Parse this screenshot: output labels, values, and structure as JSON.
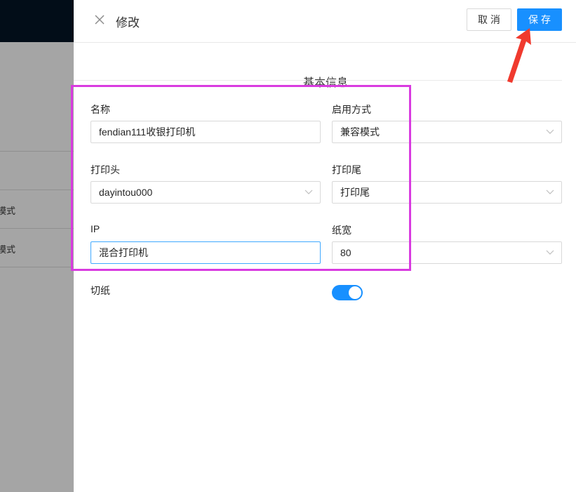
{
  "background": {
    "row_labels": [
      "模式",
      "模式"
    ]
  },
  "drawer": {
    "title": "修改",
    "cancel_label": "取消",
    "save_label": "保存",
    "section_title": "基本信息"
  },
  "form": {
    "name": {
      "label": "名称",
      "value": "fendian111收银打印机"
    },
    "enable_mode": {
      "label": "启用方式",
      "value": "兼容模式"
    },
    "print_head": {
      "label": "打印头",
      "value": "dayintou000"
    },
    "print_tail": {
      "label": "打印尾",
      "value": "打印尾"
    },
    "ip": {
      "label": "IP",
      "value": "混合打印机"
    },
    "paper_width": {
      "label": "纸宽",
      "value": "80"
    },
    "cut_paper": {
      "label": "切纸",
      "enabled": true
    }
  },
  "colors": {
    "primary": "#1890ff",
    "highlight": "#d93be0",
    "arrow": "#f03a2e"
  }
}
